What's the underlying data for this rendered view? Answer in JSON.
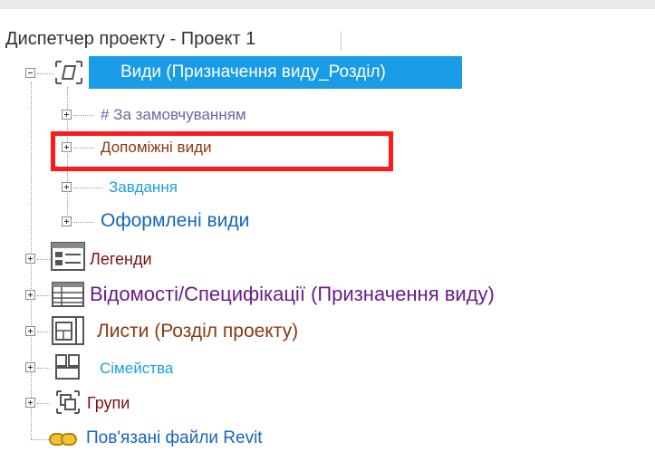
{
  "panel": {
    "title": "Диспетчер проекту - Проект 1"
  },
  "tree": {
    "views": {
      "label": "Види (Призначення виду_Розділ)"
    },
    "children": [
      {
        "label": "# За замовчуванням"
      },
      {
        "label": "Допоміжні види"
      },
      {
        "label": "Завдання"
      },
      {
        "label": "Оформлені види"
      }
    ],
    "legends": {
      "label": "Легенди"
    },
    "schedules": {
      "label": "Відомості/Специфікації (Призначення виду)"
    },
    "sheets": {
      "label": "Листи (Розділ проекту)"
    },
    "families": {
      "label": "Сімейства"
    },
    "groups": {
      "label": "Групи"
    },
    "links": {
      "label": "Пов'язані файли Revit"
    }
  },
  "colors": {
    "selection": "#1a9be6",
    "highlight_box": "#ff1a1a"
  }
}
